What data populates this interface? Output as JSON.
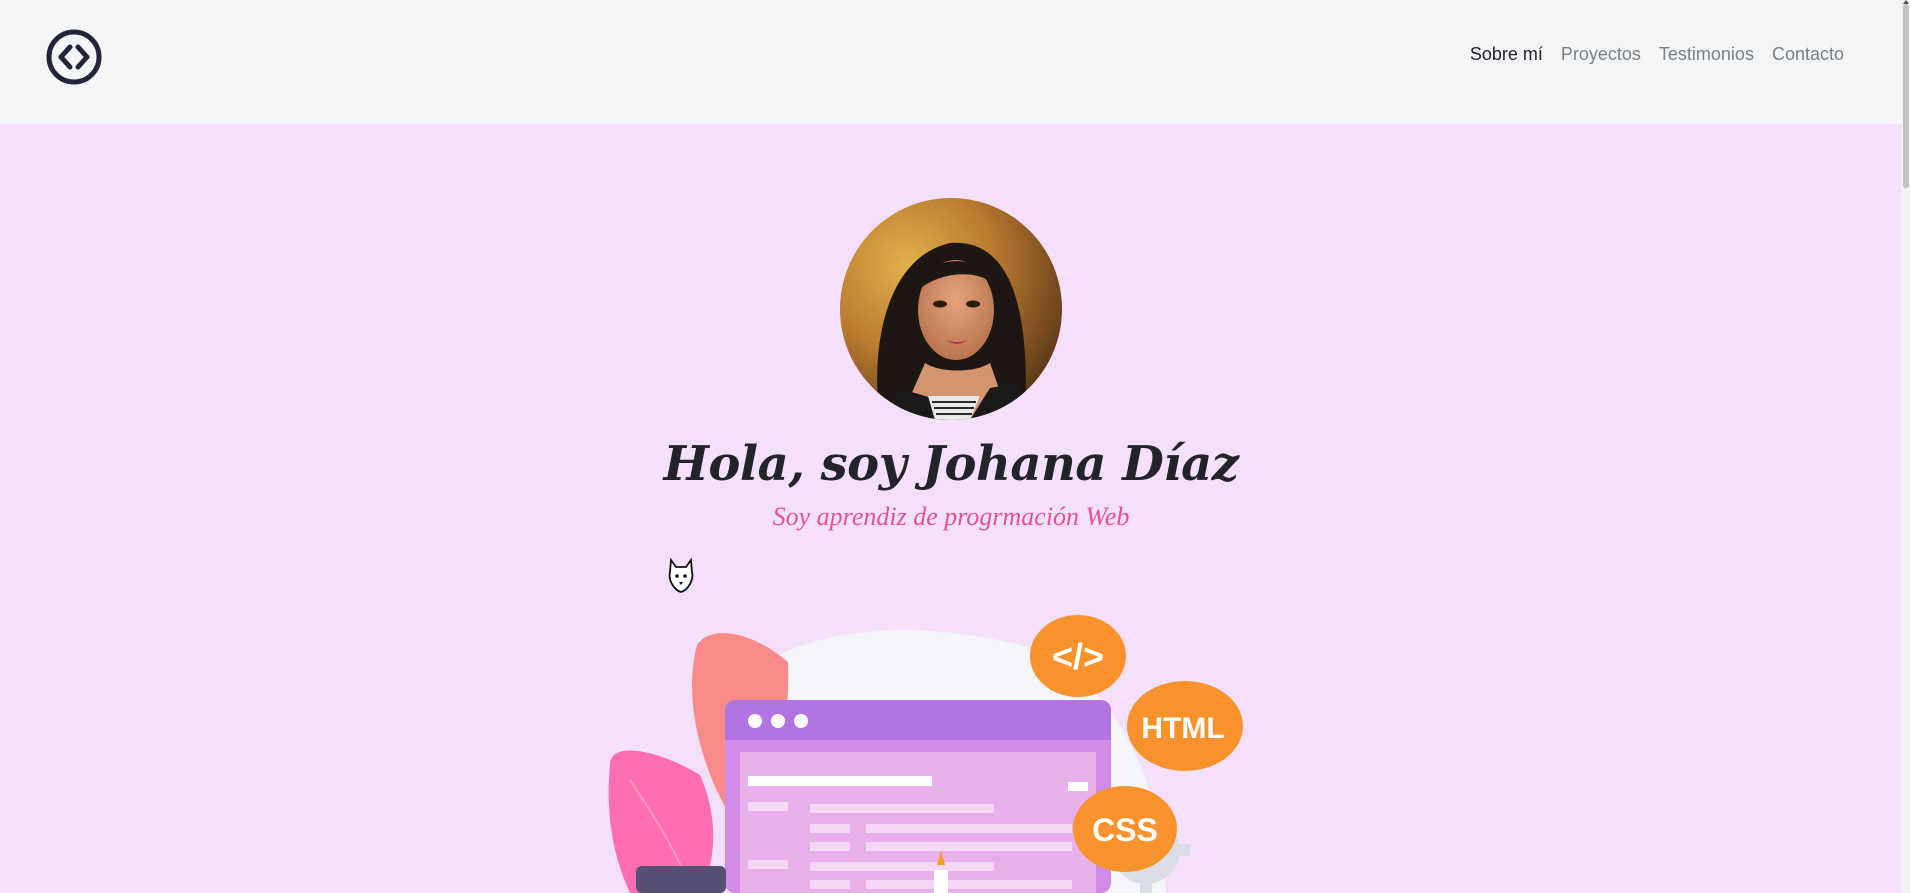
{
  "nav": {
    "items": [
      {
        "label": "Sobre mí",
        "active": true
      },
      {
        "label": "Proyectos",
        "active": false
      },
      {
        "label": "Testimonios",
        "active": false
      },
      {
        "label": "Contacto",
        "active": false
      }
    ]
  },
  "hero": {
    "title": "Hola, soy Johana Díaz",
    "subtitle": "Soy aprendiz de progrmación Web"
  },
  "illustration": {
    "badges": [
      "</>",
      "HTML",
      "CSS"
    ]
  },
  "icons": {
    "logo": "code-brackets-icon",
    "cursor": "wolf-cursor-icon"
  },
  "colors": {
    "page_background": "#f5e0fb",
    "nav_background": "#f4f5f7",
    "title": "#23242b",
    "subtitle": "#e3528f",
    "badge_orange": "#f7922d"
  }
}
